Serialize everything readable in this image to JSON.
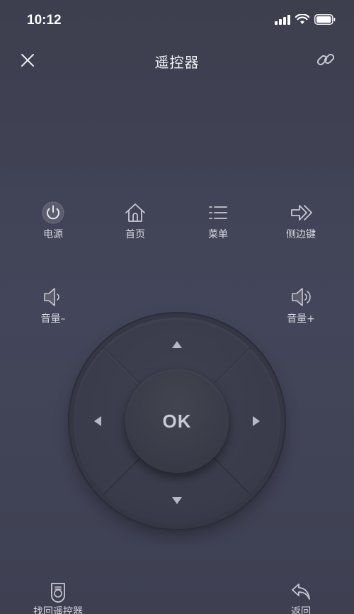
{
  "status_bar": {
    "time": "10:12"
  },
  "nav": {
    "title": "遥控器"
  },
  "functions": [
    {
      "label": "电源",
      "icon": "power-icon"
    },
    {
      "label": "首页",
      "icon": "home-icon"
    },
    {
      "label": "菜单",
      "icon": "menu-icon"
    },
    {
      "label": "侧边键",
      "icon": "side-key-icon"
    }
  ],
  "volume": {
    "down_label": "音量–",
    "up_label": "音量+"
  },
  "dpad": {
    "ok_label": "OK"
  },
  "bottom": {
    "find_label": "找回遥控器",
    "back_label": "返回"
  },
  "colors": {
    "background": "#41435a",
    "text": "#d8d9e2",
    "icon": "#c7c8d2"
  }
}
